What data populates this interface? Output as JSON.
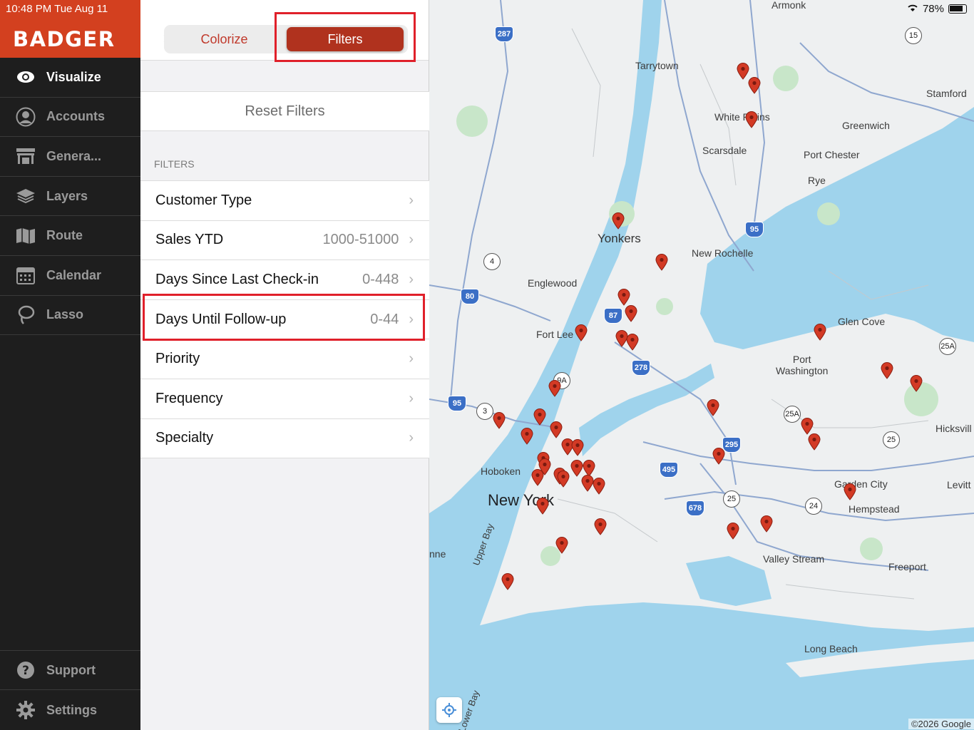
{
  "status": {
    "time": "10:48 PM  Tue Aug 11",
    "battery": "78%"
  },
  "brand": {
    "logo": "BADGER"
  },
  "sidebar": {
    "items": [
      {
        "label": "Visualize",
        "icon": "eye-icon",
        "active": true
      },
      {
        "label": "Accounts",
        "icon": "user-circle-icon"
      },
      {
        "label": "Genera...",
        "icon": "store-icon"
      },
      {
        "label": "Layers",
        "icon": "layers-icon"
      },
      {
        "label": "Route",
        "icon": "map-icon"
      },
      {
        "label": "Calendar",
        "icon": "calendar-icon"
      },
      {
        "label": "Lasso",
        "icon": "lasso-icon"
      }
    ],
    "bottom": [
      {
        "label": "Support",
        "icon": "help-icon"
      },
      {
        "label": "Settings",
        "icon": "gear-icon"
      }
    ]
  },
  "panel": {
    "close": "✕",
    "tabs": {
      "colorize": "Colorize",
      "filters": "Filters"
    },
    "reset": "Reset Filters",
    "section": "FILTERS",
    "filters": [
      {
        "label": "Customer Type",
        "value": ""
      },
      {
        "label": "Sales YTD",
        "value": "1000-51000"
      },
      {
        "label": "Days Since Last Check-in",
        "value": "0-448"
      },
      {
        "label": "Days Until Follow-up",
        "value": "0-44"
      },
      {
        "label": "Priority",
        "value": ""
      },
      {
        "label": "Frequency",
        "value": ""
      },
      {
        "label": "Specialty",
        "value": ""
      }
    ]
  },
  "map": {
    "labels": {
      "armonk": "Armonk",
      "tarrytown": "Tarrytown",
      "stamford": "Stamford",
      "white_plains": "White Plains",
      "greenwich": "Greenwich",
      "scarsdale": "Scarsdale",
      "port_chester": "Port Chester",
      "rye": "Rye",
      "yonkers": "Yonkers",
      "new_rochelle": "New Rochelle",
      "englewood": "Englewood",
      "glen_cove": "Glen Cove",
      "fort_lee": "Fort Lee",
      "port_washington": "Port\nWashington",
      "hicksville": "Hicksvill",
      "hoboken": "Hoboken",
      "new_york": "New York",
      "garden_city": "Garden City",
      "levitt": "Levitt",
      "hempstead": "Hempstead",
      "upper_bay": "Upper Bay",
      "valley_stream": "Valley Stream",
      "freeport": "Freeport",
      "long_beach": "Long Beach",
      "lower_bay": "Lower Bay",
      "ne": "nne"
    },
    "shields": [
      "287",
      "87",
      "80",
      "95",
      "278",
      "295",
      "495",
      "678",
      "95"
    ],
    "circle_shields": [
      "15",
      "4",
      "9A",
      "3",
      "25A",
      "25A",
      "25",
      "25",
      "24"
    ],
    "copyright": "©2026 Google",
    "pin_color": "#d33a25"
  }
}
